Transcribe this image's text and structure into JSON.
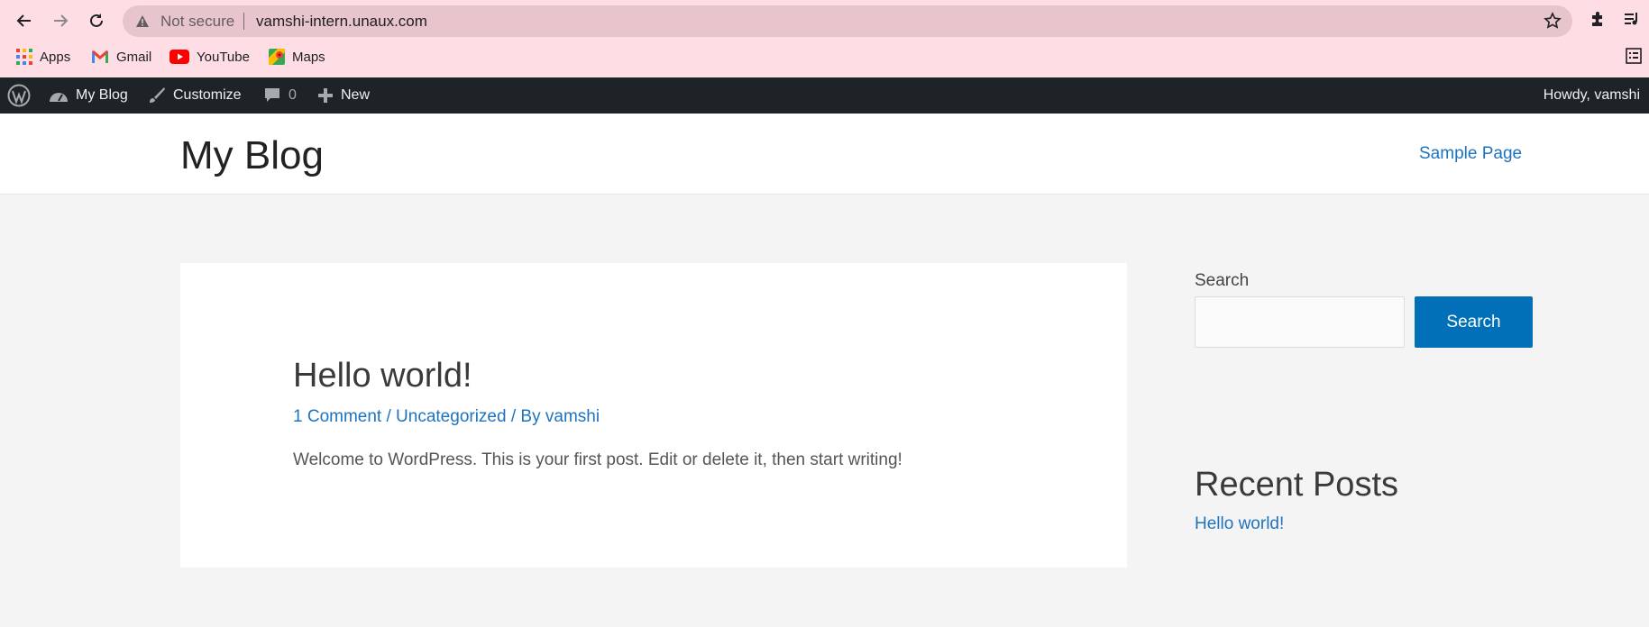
{
  "browser": {
    "security_label": "Not secure",
    "url": "vamshi-intern.unaux.com",
    "bookmarks": [
      {
        "label": "Apps",
        "icon": "apps-grid-icon"
      },
      {
        "label": "Gmail",
        "icon": "gmail-icon"
      },
      {
        "label": "YouTube",
        "icon": "youtube-icon"
      },
      {
        "label": "Maps",
        "icon": "maps-icon"
      }
    ]
  },
  "admin_bar": {
    "site_name": "My Blog",
    "customize": "Customize",
    "comments_count": "0",
    "new_label": "New",
    "greeting": "Howdy, vamshi"
  },
  "header": {
    "site_title": "My Blog",
    "menu_item": "Sample Page"
  },
  "post": {
    "title": "Hello world!",
    "comments": "1 Comment",
    "separator": " / ",
    "category": "Uncategorized",
    "by": "By ",
    "author": "vamshi",
    "excerpt": "Welcome to WordPress. This is your first post. Edit or delete it, then start writing!"
  },
  "sidebar": {
    "search_label": "Search",
    "search_button": "Search",
    "search_value": "",
    "recent_title": "Recent Posts",
    "recent_posts": [
      "Hello world!"
    ]
  },
  "colors": {
    "chrome_bg": "#ffdde4",
    "admin_bar": "#1d2327",
    "link": "#1e73be",
    "button": "#0170b9"
  }
}
